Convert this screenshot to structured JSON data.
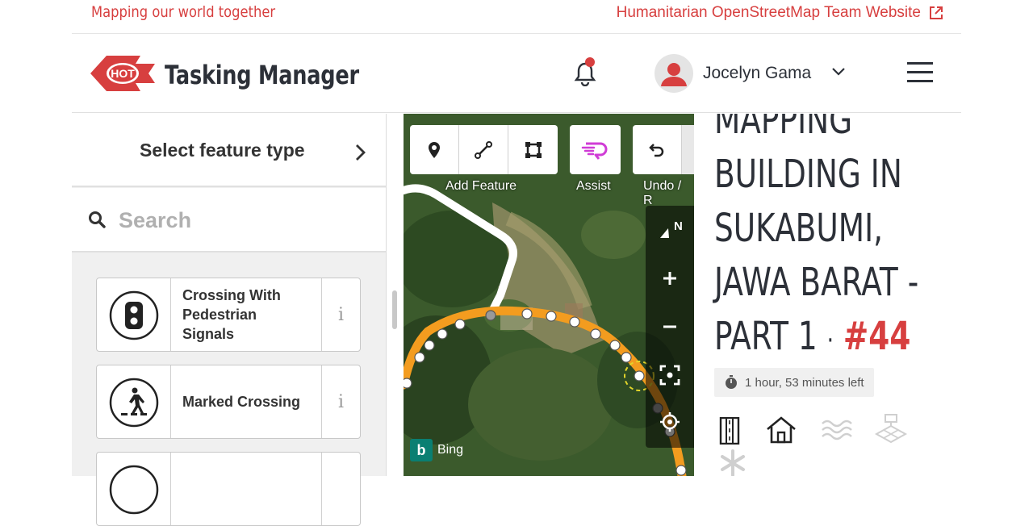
{
  "topbar": {
    "tagline": "Mapping our world together",
    "website_link": "Humanitarian OpenStreetMap Team Website"
  },
  "navbar": {
    "logo_text": "HOT",
    "brand": "Tasking Manager",
    "user": {
      "name": "Jocelyn Gama"
    }
  },
  "left_panel": {
    "title": "Select feature type",
    "search": {
      "placeholder": "Search",
      "value": ""
    },
    "presets": [
      {
        "label": "Crossing With Pedestrian Signals",
        "icon": "pedestrian-signal-icon"
      },
      {
        "label": "Marked Crossing",
        "icon": "marked-crossing-icon"
      },
      {
        "label": "",
        "icon": "crossing-icon"
      }
    ]
  },
  "map": {
    "toolbar": {
      "add_feature_label": "Add Feature",
      "assist_label": "Assist",
      "undo_label": "Undo / R"
    },
    "compass_label": "N",
    "attribution": "Bing"
  },
  "project": {
    "title_lines": [
      "MAPPING",
      "BUILDING IN",
      "SUKABUMI,",
      "JAWA BARAT -",
      "PART 1"
    ],
    "separator": "·",
    "id": "#44",
    "time_left": "1 hour, 53 minutes left",
    "feature_types": [
      "roads-icon",
      "buildings-icon",
      "waterways-icon",
      "landuse-icon",
      "other-icon"
    ]
  },
  "colors": {
    "brand_red": "#d73f3f",
    "text_dark": "#2c3038",
    "way_orange": "#f39c1f",
    "assist_magenta": "#d03cd6"
  }
}
